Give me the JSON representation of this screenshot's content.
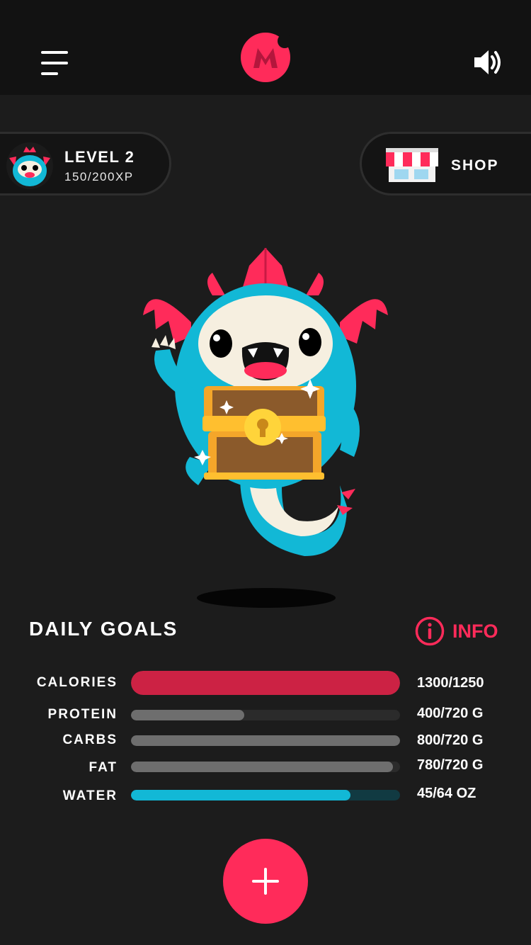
{
  "header": {
    "menu_icon": "hamburger-menu-icon",
    "logo_icon": "m-logo-icon",
    "sound_icon": "speaker-icon"
  },
  "level": {
    "title": "LEVEL 2",
    "xp": "150/200XP",
    "avatar_icon": "dragon-avatar-icon"
  },
  "shop": {
    "label": "SHOP",
    "icon": "storefront-icon"
  },
  "mascot": {
    "icon": "dragon-with-treasure-chest"
  },
  "daily_goals": {
    "title": "DAILY GOALS",
    "info_label": "INFO",
    "info_icon": "info-circle-icon",
    "items": [
      {
        "label": "CALORIES",
        "value": "1300/1250",
        "progress": 1.0,
        "color": "#cc2244"
      },
      {
        "label": "PROTEIN",
        "value": "400/720 G",
        "progress": 0.42,
        "color": "#6e6e6e"
      },
      {
        "label": "CARBS",
        "value": "800/720 G",
        "progress": 1.0,
        "color": "#6e6e6e"
      },
      {
        "label": "FAT",
        "value": "780/720 G",
        "progress": 0.974,
        "color": "#6e6e6e"
      },
      {
        "label": "WATER",
        "value": "45/64 OZ",
        "progress": 0.816,
        "color": "#12b8d6"
      }
    ]
  },
  "add_button": {
    "icon": "plus-icon"
  },
  "colors": {
    "accent": "#ff2b5a",
    "background": "#1c1c1c",
    "topbar": "#121212",
    "water": "#12b8d6",
    "calories": "#cc2244"
  }
}
